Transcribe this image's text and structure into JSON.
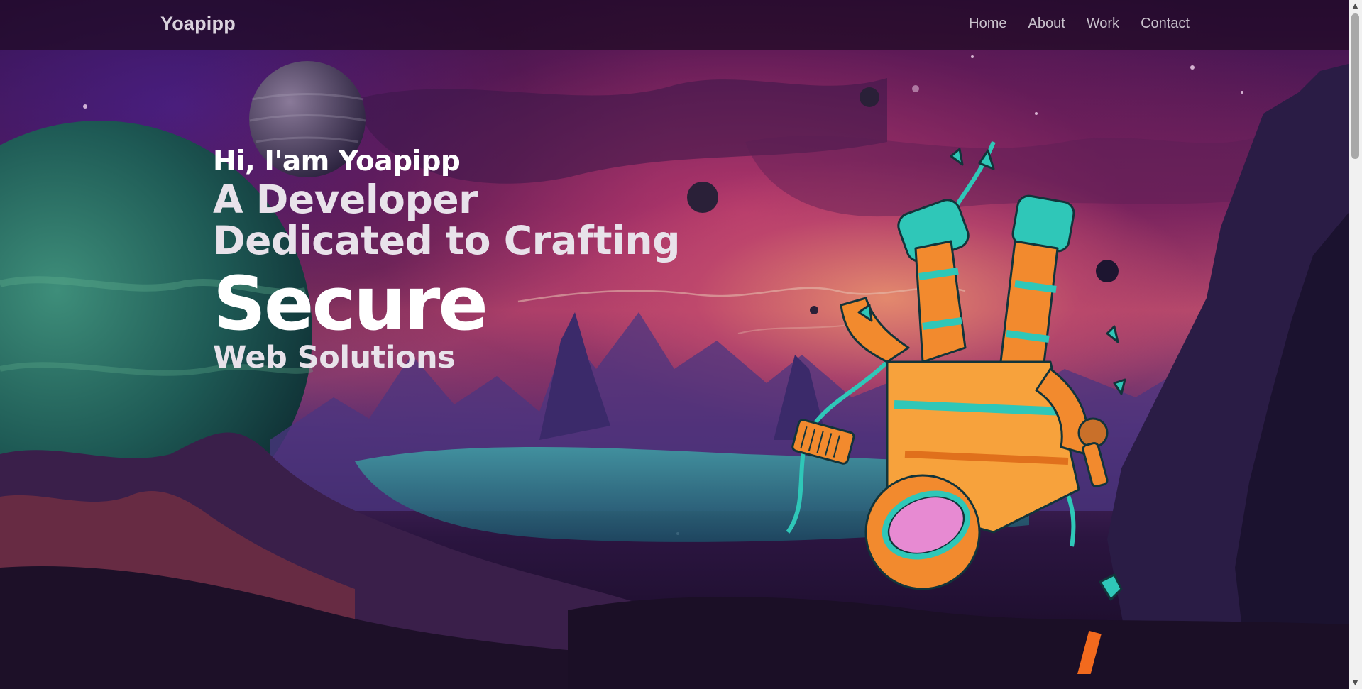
{
  "navbar": {
    "brand": "Yoapipp",
    "links": [
      "Home",
      "About",
      "Work",
      "Contact"
    ]
  },
  "hero": {
    "greeting": "Hi, I'am Yoapipp",
    "line2": "A Developer",
    "line3": "Dedicated to Crafting",
    "highlight": "Secure",
    "line5": "Web Solutions"
  },
  "colors": {
    "navbar_bg": "#1e0a23",
    "text_primary": "#ffffff",
    "suit_orange": "#f28a2e",
    "suit_teal": "#2fc7b8"
  },
  "icons": [
    "astronaut-illustration",
    "planet-icon",
    "scroll-up-icon",
    "scroll-down-icon"
  ]
}
